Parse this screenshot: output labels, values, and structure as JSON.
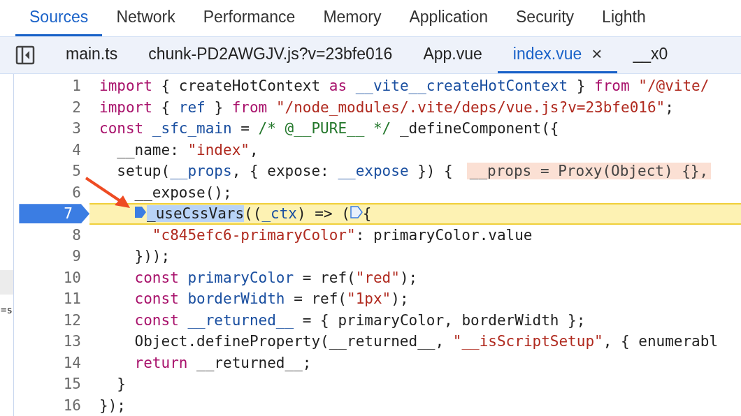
{
  "panel_tabs": [
    {
      "label": "Sources",
      "selected": true
    },
    {
      "label": "Network",
      "selected": false
    },
    {
      "label": "Performance",
      "selected": false
    },
    {
      "label": "Memory",
      "selected": false
    },
    {
      "label": "Application",
      "selected": false
    },
    {
      "label": "Security",
      "selected": false
    },
    {
      "label": "Lighth",
      "selected": false
    }
  ],
  "file_tabs": [
    {
      "label": "main.ts",
      "selected": false
    },
    {
      "label": "chunk-PD2AWGJV.js?v=23bfe016",
      "selected": false
    },
    {
      "label": "App.vue",
      "selected": false
    },
    {
      "label": "index.vue",
      "selected": true,
      "close": "×"
    },
    {
      "label": "__x0",
      "selected": false
    }
  ],
  "side_panel": {
    "text": "=s"
  },
  "code": [
    {
      "number": "1",
      "current": false,
      "tokens": [
        {
          "kind": "keyword",
          "t": "import "
        },
        {
          "kind": "plain",
          "t": "{ createHotContext "
        },
        {
          "kind": "keyword",
          "t": "as "
        },
        {
          "kind": "name",
          "t": "__vite__createHotContext "
        },
        {
          "kind": "plain",
          "t": "} "
        },
        {
          "kind": "keyword",
          "t": "from "
        },
        {
          "kind": "string",
          "t": "\"/@vite/"
        }
      ]
    },
    {
      "number": "2",
      "current": false,
      "tokens": [
        {
          "kind": "keyword",
          "t": "import "
        },
        {
          "kind": "plain",
          "t": "{ "
        },
        {
          "kind": "name",
          "t": "ref "
        },
        {
          "kind": "plain",
          "t": "} "
        },
        {
          "kind": "keyword",
          "t": "from "
        },
        {
          "kind": "string",
          "t": "\"/node_modules/.vite/deps/vue.js?v=23bfe016\""
        },
        {
          "kind": "plain",
          "t": ";"
        }
      ]
    },
    {
      "number": "3",
      "current": false,
      "tokens": [
        {
          "kind": "keyword",
          "t": "const "
        },
        {
          "kind": "name",
          "t": "_sfc_main "
        },
        {
          "kind": "plain",
          "t": "= "
        },
        {
          "kind": "comment",
          "t": "/* @__PURE__ */ "
        },
        {
          "kind": "plain",
          "t": "_defineComponent({"
        }
      ]
    },
    {
      "number": "4",
      "current": false,
      "tokens": [
        {
          "kind": "plain",
          "t": "  __name: "
        },
        {
          "kind": "string",
          "t": "\"index\""
        },
        {
          "kind": "plain",
          "t": ","
        }
      ]
    },
    {
      "number": "5",
      "current": false,
      "tokens": [
        {
          "kind": "plain",
          "t": "  setup("
        },
        {
          "kind": "name",
          "t": "__props"
        },
        {
          "kind": "plain",
          "t": ", { expose: "
        },
        {
          "kind": "name",
          "t": "__expose "
        },
        {
          "kind": "plain",
          "t": "}) {"
        },
        {
          "kind": "inline",
          "t": "__props = Proxy(Object) {},"
        }
      ]
    },
    {
      "number": "6",
      "current": false,
      "tokens": [
        {
          "kind": "plain",
          "t": "    __expose();"
        }
      ]
    },
    {
      "number": "7",
      "current": true,
      "tokens": [
        {
          "kind": "marker"
        },
        {
          "kind": "selection",
          "t": "_useCssVars"
        },
        {
          "kind": "plain",
          "t": "(("
        },
        {
          "kind": "name",
          "t": "_ctx"
        },
        {
          "kind": "plain",
          "t": ") => ("
        },
        {
          "kind": "hollow_marker"
        },
        {
          "kind": "plain",
          "t": "{"
        }
      ]
    },
    {
      "number": "8",
      "current": false,
      "tokens": [
        {
          "kind": "string",
          "t": "      \"c845efc6-primaryColor\""
        },
        {
          "kind": "plain",
          "t": ": primaryColor.value"
        }
      ]
    },
    {
      "number": "9",
      "current": false,
      "tokens": [
        {
          "kind": "plain",
          "t": "    }));"
        }
      ]
    },
    {
      "number": "10",
      "current": false,
      "tokens": [
        {
          "kind": "keyword",
          "t": "    const "
        },
        {
          "kind": "name",
          "t": "primaryColor "
        },
        {
          "kind": "plain",
          "t": "= ref("
        },
        {
          "kind": "string",
          "t": "\"red\""
        },
        {
          "kind": "plain",
          "t": ");"
        }
      ]
    },
    {
      "number": "11",
      "current": false,
      "tokens": [
        {
          "kind": "keyword",
          "t": "    const "
        },
        {
          "kind": "name",
          "t": "borderWidth "
        },
        {
          "kind": "plain",
          "t": "= ref("
        },
        {
          "kind": "string",
          "t": "\"1px\""
        },
        {
          "kind": "plain",
          "t": ");"
        }
      ]
    },
    {
      "number": "12",
      "current": false,
      "tokens": [
        {
          "kind": "keyword",
          "t": "    const "
        },
        {
          "kind": "name",
          "t": "__returned__ "
        },
        {
          "kind": "plain",
          "t": "= { primaryColor, borderWidth };"
        }
      ]
    },
    {
      "number": "13",
      "current": false,
      "tokens": [
        {
          "kind": "plain",
          "t": "    Object.defineProperty(__returned__, "
        },
        {
          "kind": "string",
          "t": "\"__isScriptSetup\""
        },
        {
          "kind": "plain",
          "t": ", { enumerabl"
        }
      ]
    },
    {
      "number": "14",
      "current": false,
      "tokens": [
        {
          "kind": "keyword",
          "t": "    return "
        },
        {
          "kind": "plain",
          "t": "__returned__;"
        }
      ]
    },
    {
      "number": "15",
      "current": false,
      "tokens": [
        {
          "kind": "plain",
          "t": "  }"
        }
      ]
    },
    {
      "number": "16",
      "current": false,
      "tokens": [
        {
          "kind": "plain",
          "t": "});"
        }
      ]
    }
  ]
}
